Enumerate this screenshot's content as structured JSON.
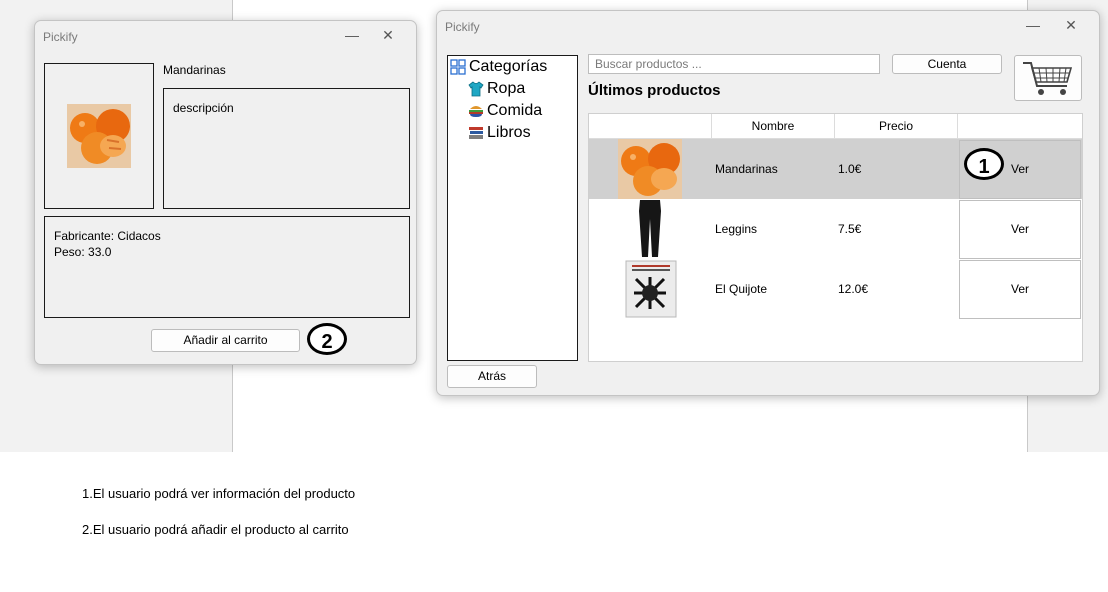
{
  "left_window": {
    "title": "Pickify",
    "product_name": "Mandarinas",
    "description": "descripción",
    "manufacturer": "Fabricante: Cidacos",
    "weight": "Peso: 33.0",
    "add_to_cart_label": "Añadir al carrito",
    "marker": "2"
  },
  "right_window": {
    "title": "Pickify",
    "search_placeholder": "Buscar productos ...",
    "account_label": "Cuenta",
    "latest_title": "Últimos productos",
    "back_label": "Atrás",
    "marker": "1",
    "categories": {
      "root": "Categorías",
      "items": [
        "Ropa",
        "Comida",
        "Libros"
      ]
    },
    "table": {
      "headers": [
        "",
        "Nombre",
        "Precio",
        ""
      ],
      "rows": [
        {
          "image": "mandarin-image",
          "name": "Mandarinas",
          "price": "1.0€",
          "action": "Ver",
          "selected": true
        },
        {
          "image": "leggings-image",
          "name": "Leggins",
          "price": "7.5€",
          "action": "Ver",
          "selected": false
        },
        {
          "image": "book-image",
          "name": "El Quijote",
          "price": "12.0€",
          "action": "Ver",
          "selected": false
        }
      ]
    }
  },
  "notes": [
    "1.El usuario podrá ver información del producto",
    "2.El usuario podrá añadir el producto al carrito"
  ],
  "colors": {
    "selected_row": "#d0d0d0",
    "window_bg": "#f0f0f0",
    "ropa_icon": "#1fa7c4"
  }
}
